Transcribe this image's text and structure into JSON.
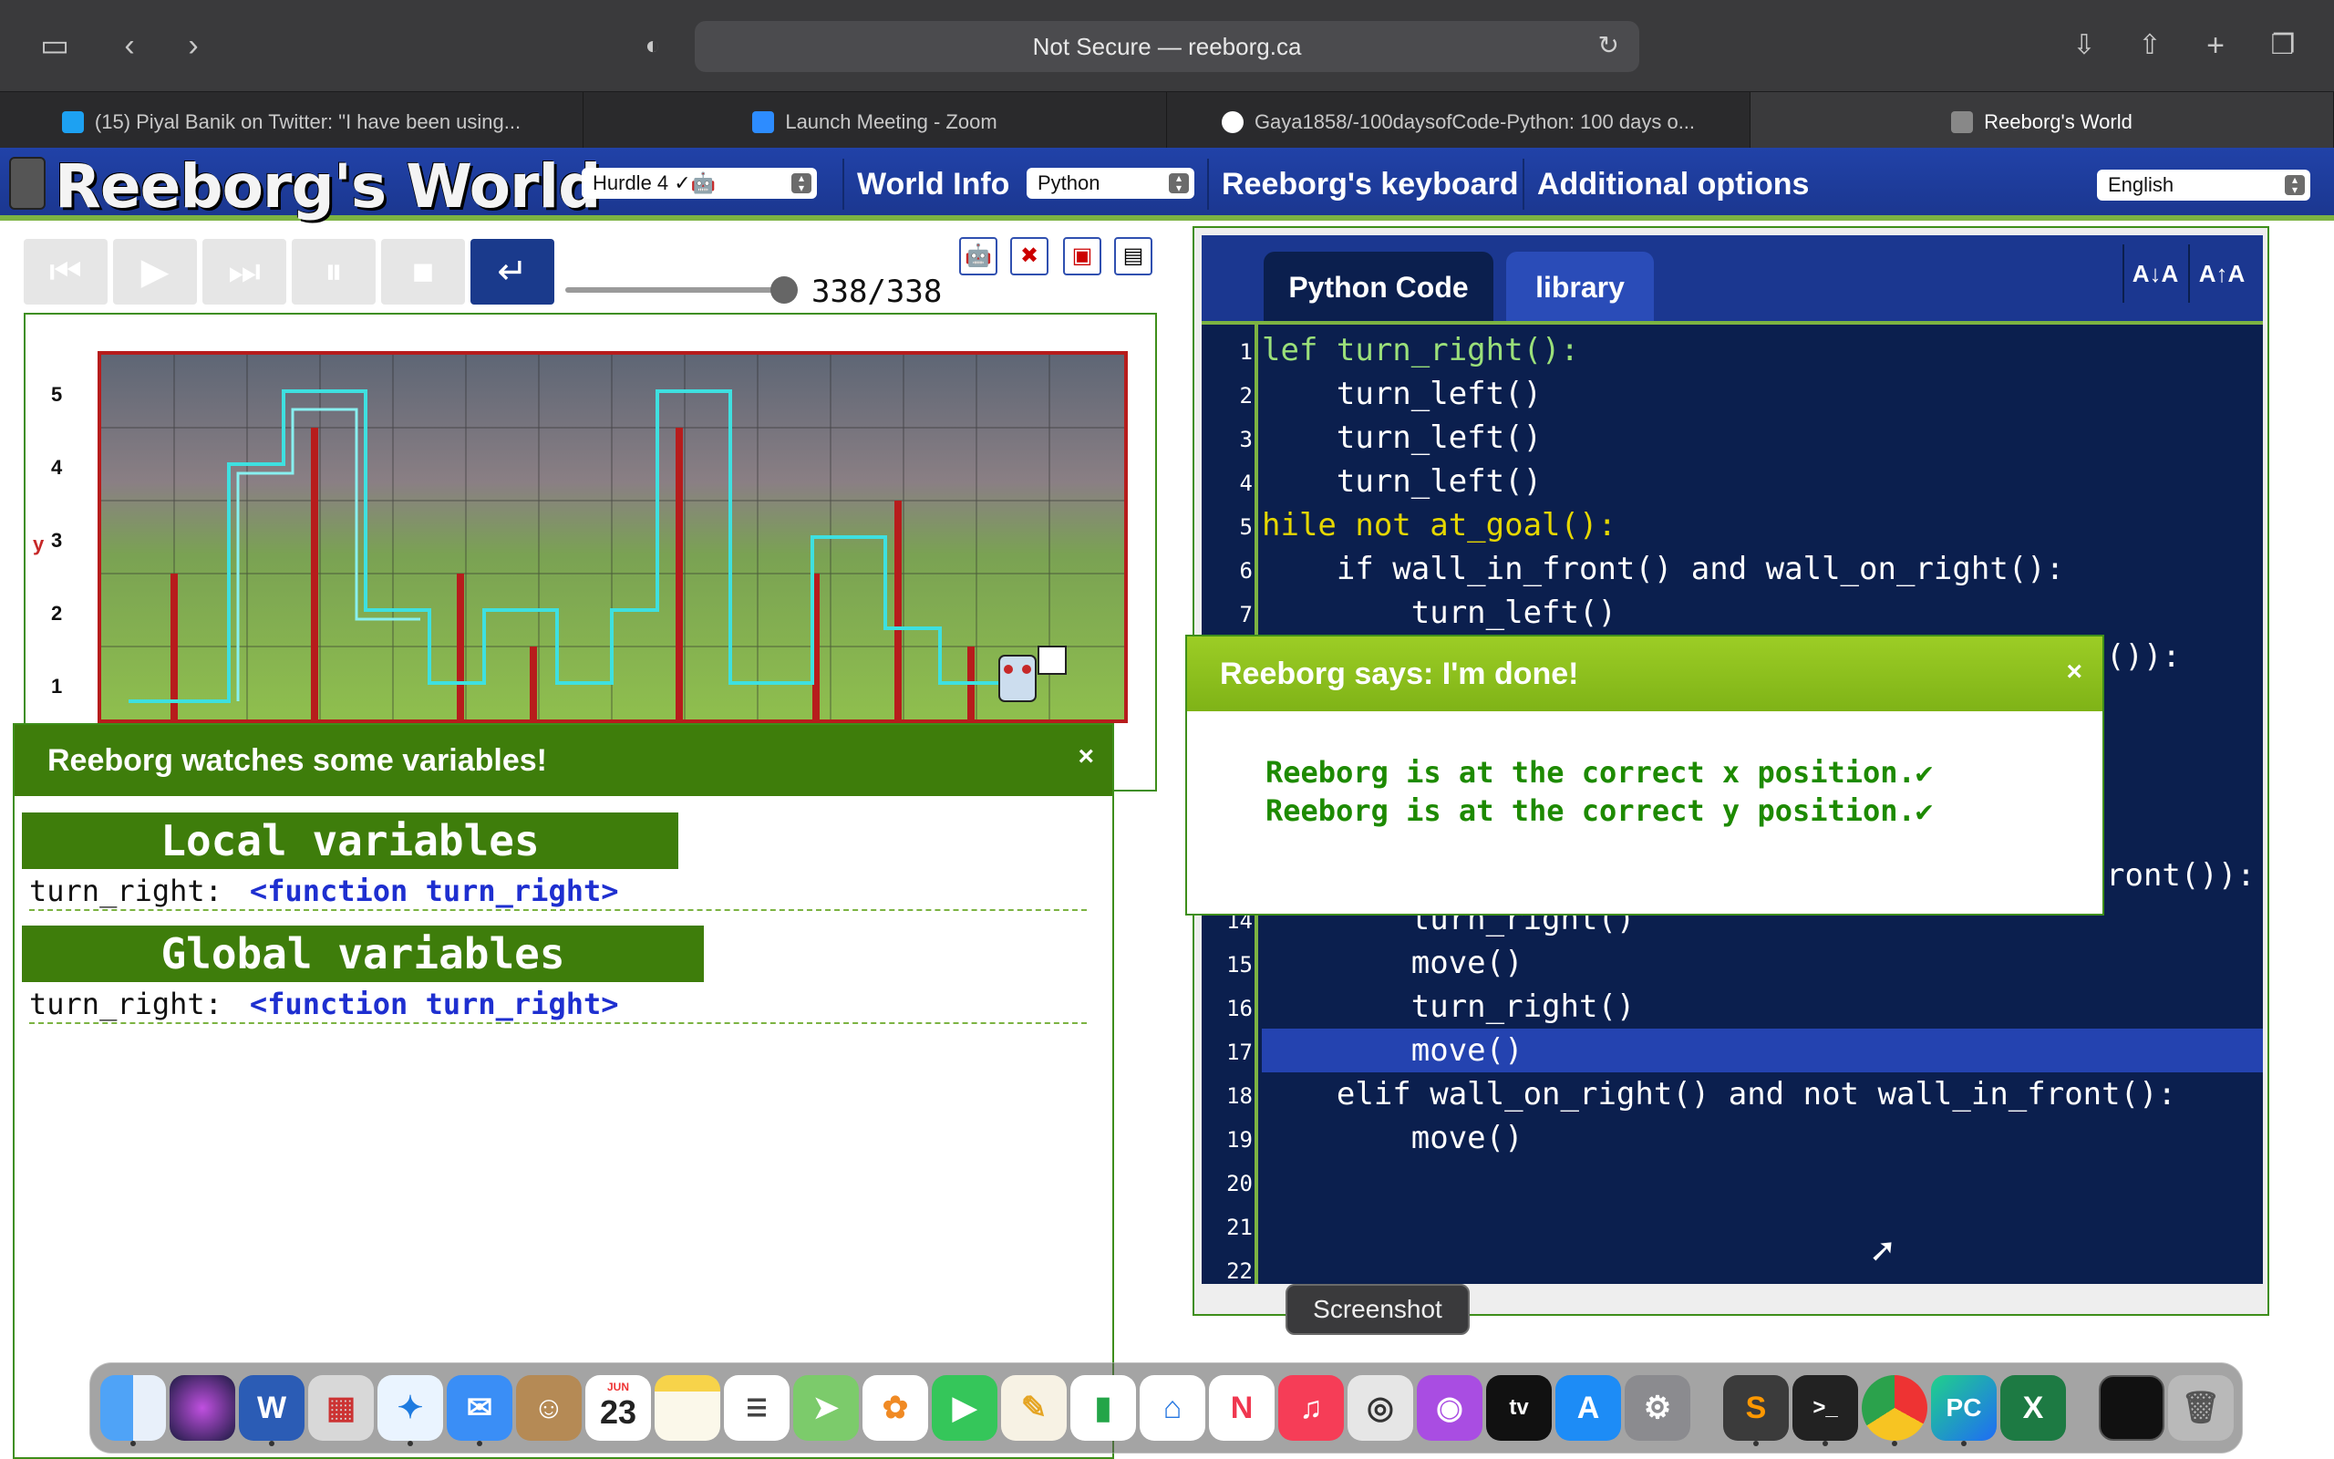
{
  "browser": {
    "url_text": "Not Secure — reeborg.ca",
    "tabs": [
      {
        "label": "(15) Piyal Banik on Twitter: \"I have been using...",
        "icon": "twitter-icon",
        "color": "#1da1f2"
      },
      {
        "label": "Launch Meeting - Zoom",
        "icon": "zoom-icon",
        "color": "#2d8cff"
      },
      {
        "label": "Gaya1858/-100daysofCode-Python: 100 days o...",
        "icon": "github-icon",
        "color": "#ffffff"
      },
      {
        "label": "Reeborg's World",
        "icon": "reeborg-icon",
        "color": "#888888"
      }
    ]
  },
  "app": {
    "title": "Reeborg's World",
    "world_select": "Hurdle 4 ✓🤖",
    "menu_world_info": "World Info",
    "language_select": "Python",
    "menu_keyboard": "Reeborg's keyboard",
    "menu_additional": "Additional options",
    "ui_language": "English"
  },
  "controls": {
    "step_counter": "338/338",
    "step_current": 338,
    "step_total": 338,
    "buttons": [
      "first-step",
      "run",
      "step",
      "pause",
      "stop",
      "reload"
    ]
  },
  "world": {
    "y_axis_labels": [
      "5",
      "4",
      "3",
      "2",
      "1"
    ],
    "y_axis_letter": "y",
    "cols": 14,
    "rows": 5
  },
  "variables_panel": {
    "header": "Reeborg watches some variables!",
    "close": "×",
    "local_title": "Local variables",
    "local_vars": [
      {
        "name": "turn_right:",
        "value": "<function turn_right>"
      }
    ],
    "global_title": "Global variables",
    "global_vars": [
      {
        "name": "turn_right:",
        "value": "<function turn_right>"
      }
    ]
  },
  "editor": {
    "tab_code": "Python Code",
    "tab_library": "library",
    "font_decrease": "A↓A",
    "font_increase": "A↑A",
    "line_numbers": [
      "1",
      "2",
      "3",
      "4",
      "5",
      "6",
      "7",
      "14",
      "15",
      "16",
      "17",
      "18",
      "19",
      "20",
      "21",
      "22"
    ],
    "highlighted_line": "17",
    "visible_code": {
      "l1": "lef turn_right():",
      "l2": "    turn_left()",
      "l3": "    turn_left()",
      "l4": "    turn_left()",
      "l5": "hile not at_goal():",
      "l6": "    if wall_in_front() and wall_on_right():",
      "l7": "        turn_left()",
      "l8_partial": "()):",
      "l13_partial": "ront()):",
      "l14": "        turn_right()",
      "l15": "        move()",
      "l16": "        turn_right()",
      "l17": "        move()",
      "l18": "    elif wall_on_right() and not wall_in_front():",
      "l19": "        move()"
    }
  },
  "done_popup": {
    "title": "Reeborg says: I'm done!",
    "close": "×",
    "line1": "Reeborg is at the correct x position.✔",
    "line2": "Reeborg is at the correct y position.✔"
  },
  "dock": {
    "tooltip": "Screenshot",
    "calendar_month": "JUN",
    "calendar_day": "23",
    "apps": [
      "finder",
      "siri",
      "word",
      "launchpad",
      "safari",
      "mail",
      "contacts",
      "calendar",
      "notes",
      "reminders",
      "maps",
      "photos",
      "facetime",
      "freeform",
      "numbers",
      "keynote",
      "news",
      "music",
      "screenshot",
      "podcasts",
      "appletv",
      "appstore",
      "system-preferences",
      "sublime",
      "terminal",
      "chrome",
      "pycharm",
      "excel",
      "window-preview",
      "trash"
    ]
  }
}
